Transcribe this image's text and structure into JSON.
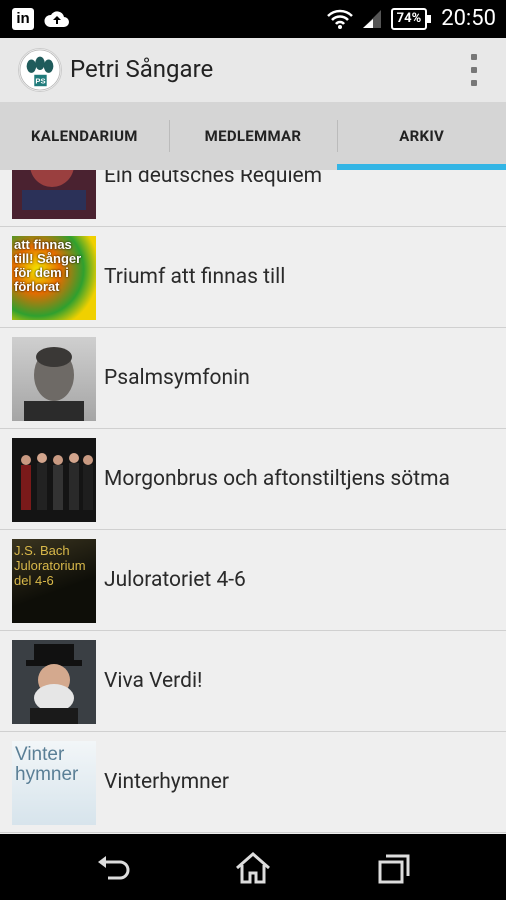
{
  "status_bar": {
    "battery": "74%",
    "time": "20:50",
    "icons": [
      "linkedin-icon",
      "cloud-upload-icon",
      "wifi-icon",
      "signal-icon",
      "battery-icon"
    ]
  },
  "app": {
    "title": "Petri Sångare"
  },
  "tabs": [
    {
      "label": "KALENDARIUM",
      "active": false
    },
    {
      "label": "MEDLEMMAR",
      "active": false
    },
    {
      "label": "ARKIV",
      "active": true
    }
  ],
  "archive": [
    {
      "title": "Ein deutsches Requiem",
      "thumb": "requiem-cover"
    },
    {
      "title": "Triumf att finnas till",
      "thumb": "triumf-cover"
    },
    {
      "title": "Psalmsymfonin",
      "thumb": "stravinsky-portrait"
    },
    {
      "title": "Morgonbrus och aftonstiltjens sötma",
      "thumb": "choir-photo"
    },
    {
      "title": "Juloratoriet 4-6",
      "thumb": "bach-cover"
    },
    {
      "title": "Viva Verdi!",
      "thumb": "verdi-portrait"
    },
    {
      "title": "Vinterhymner",
      "thumb": "vinterhymner-cover"
    }
  ],
  "thumb_texts": {
    "triumf": "att finnas till! Sånger för dem i förlorat",
    "bach": "J.S. Bach Juloratorium del 4-6",
    "vinter": "Vinter hymner"
  },
  "nav": [
    "back-icon",
    "home-icon",
    "recents-icon"
  ],
  "colors": {
    "accent": "#33b5e5",
    "actionbar": "#e8e8e8",
    "tabs": "#d5d5d5"
  }
}
